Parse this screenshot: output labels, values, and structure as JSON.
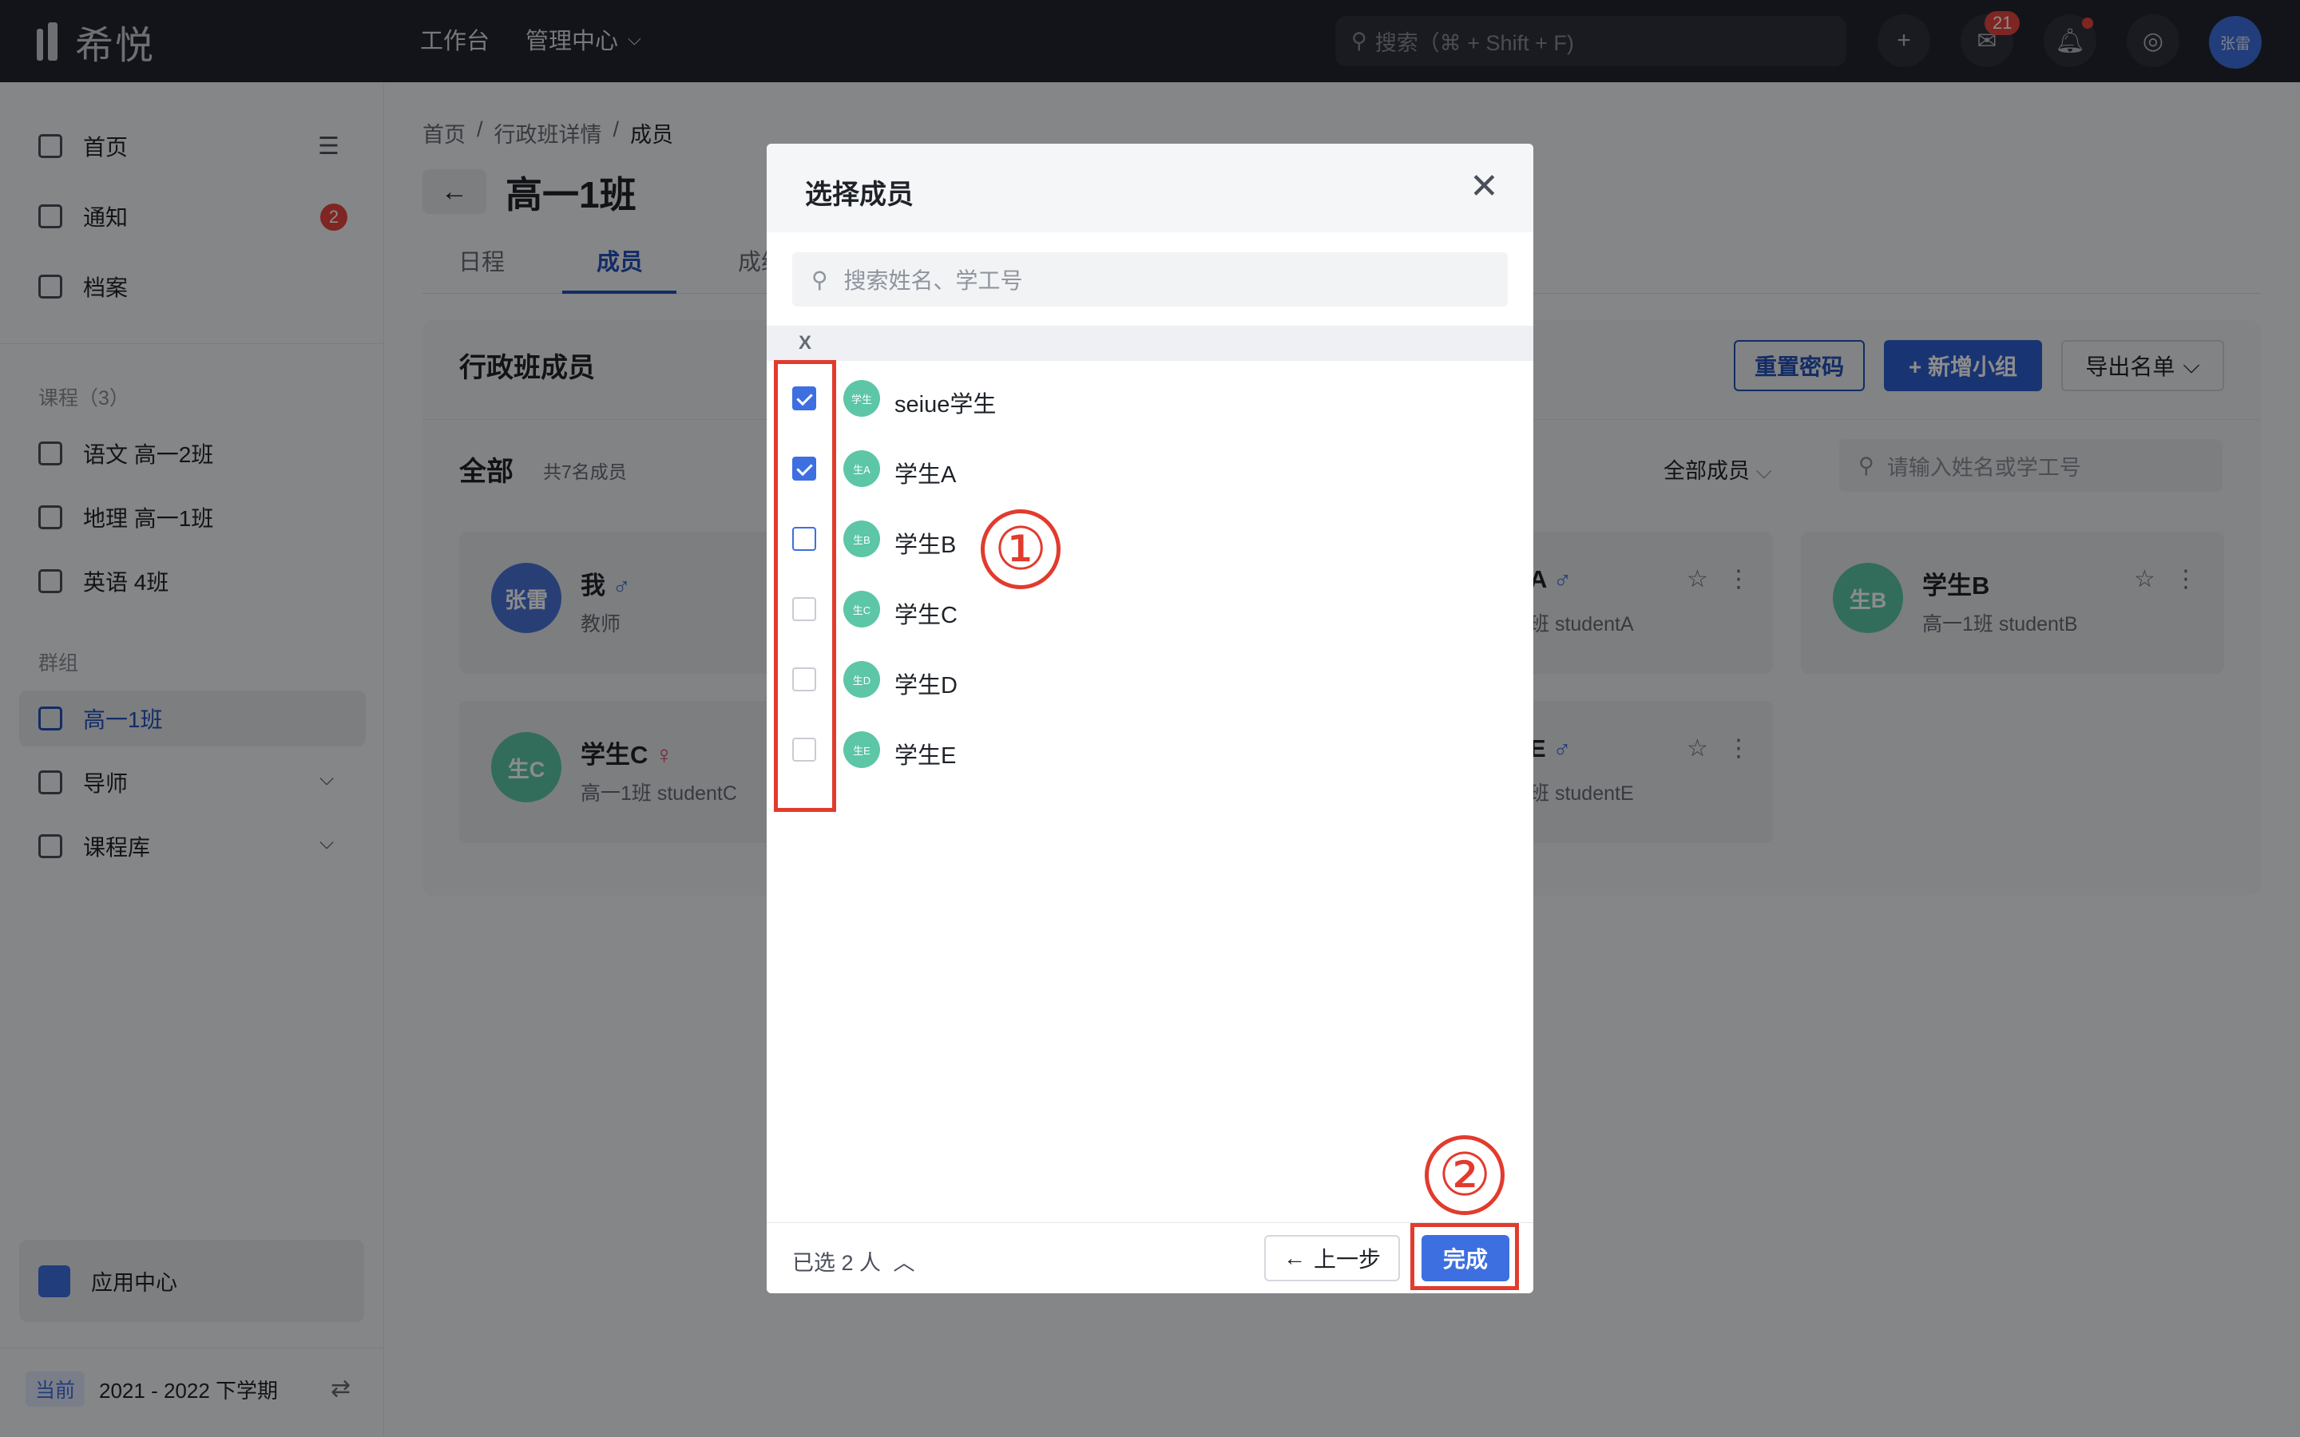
{
  "topbar": {
    "logo_text": "希悦",
    "nav_workbench": "工作台",
    "nav_admin": "管理中心",
    "search_placeholder": "搜索（⌘ + Shift + F)",
    "msg_badge": "21",
    "avatar": "张雷"
  },
  "sidebar": {
    "items": [
      {
        "label": "首页"
      },
      {
        "label": "通知",
        "badge": "2"
      },
      {
        "label": "档案"
      }
    ],
    "courses_label": "课程（3）",
    "courses": [
      {
        "label": "语文 高一2班"
      },
      {
        "label": "地理 高一1班"
      },
      {
        "label": "英语 4班"
      }
    ],
    "groups_label": "群组",
    "groups": [
      {
        "label": "高一1班",
        "active": true
      },
      {
        "label": "导师"
      },
      {
        "label": "课程库"
      }
    ],
    "app_center": "应用中心",
    "term_tag": "当前",
    "term": "2021 - 2022 下学期"
  },
  "main": {
    "breadcrumb": [
      "首页",
      "行政班详情",
      "成员"
    ],
    "title": "高一1班",
    "tabs": [
      "日程",
      "成员",
      "成绩"
    ],
    "card_title": "行政班成员",
    "btn_reset": "重置密码",
    "btn_add_group": "+ 新增小组",
    "btn_export": "导出名单",
    "all_label": "全部",
    "all_count": "共7名成员",
    "filter": "全部成员",
    "search_placeholder": "请输入姓名或学工号",
    "members": [
      {
        "avatar": "张雷",
        "name": "我",
        "gender": "♂",
        "sub": "教师"
      },
      {
        "avatar": "",
        "name": "A",
        "gender": "♂",
        "sub": "班 studentA"
      },
      {
        "avatar": "生B",
        "name": "学生B",
        "gender": "",
        "sub": "高一1班 studentB"
      },
      {
        "avatar": "生C",
        "name": "学生C",
        "gender": "♀",
        "sub": "高一1班 studentC"
      },
      {
        "avatar": "",
        "name": "E",
        "gender": "♂",
        "sub": "班 studentE"
      }
    ]
  },
  "modal": {
    "title": "选择成员",
    "search_placeholder": "搜索姓名、学工号",
    "group_letter": "X",
    "rows": [
      {
        "avatar": "学生",
        "name": "seiue学生",
        "checked": true
      },
      {
        "avatar": "生A",
        "name": "学生A",
        "checked": true
      },
      {
        "avatar": "生B",
        "name": "学生B",
        "checked": false
      },
      {
        "avatar": "生C",
        "name": "学生C",
        "checked": false
      },
      {
        "avatar": "生D",
        "name": "学生D",
        "checked": false
      },
      {
        "avatar": "生E",
        "name": "学生E",
        "checked": false
      }
    ],
    "selected_count": "已选 2 人",
    "prev_label": "上一步",
    "finish_label": "完成"
  },
  "annotations": {
    "step1": "①",
    "step2": "②",
    "color": "#e23b2e"
  },
  "colors": {
    "accent": "#3d6fe0",
    "topbar": "#23252e",
    "member_avatar": "#5cc6a6"
  }
}
